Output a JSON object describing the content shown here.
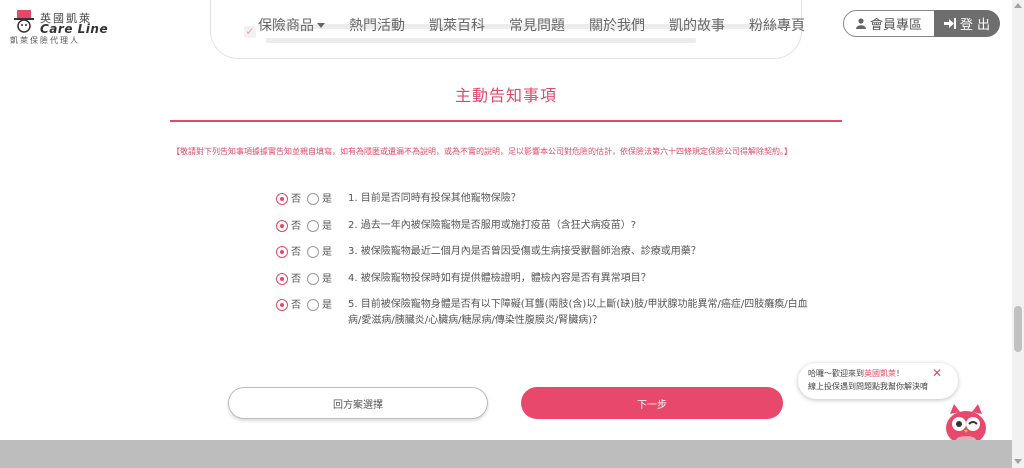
{
  "header": {
    "logo": {
      "zh_name": "英國凱萊",
      "en_name": "Care Line",
      "tagline": "凱萊保險代理人"
    },
    "nav": [
      {
        "label": "保險商品",
        "has_dropdown": true
      },
      {
        "label": "熱門活動"
      },
      {
        "label": "凱萊百科"
      },
      {
        "label": "常見問題"
      },
      {
        "label": "關於我們"
      },
      {
        "label": "凱的故事"
      },
      {
        "label": "粉絲專頁"
      }
    ],
    "member_label": "會員專區",
    "login_label": "登 出",
    "member_icon": "user-icon",
    "login_icon": "sign-in-icon"
  },
  "section": {
    "title": "主動告知事項",
    "notice": "【敬請對下列告知事項據據實告知並親自填寫，如有為隱匿或遺漏不為說明，或為不實的說明，足以影響本公司對危險的估計，依保險法第六十四條規定保險公司得解除契約。】"
  },
  "options": {
    "no": "否",
    "yes": "是"
  },
  "questions": [
    {
      "text": "1. 目前是否同時有投保其他寵物保險？",
      "answer": "no"
    },
    {
      "text": "2. 過去一年內被保險寵物是否服用或施打疫苗（含狂犬病疫苗）?",
      "answer": "no"
    },
    {
      "text": "3. 被保險寵物最近二個月內是否曾因受傷或生病接受獸醫師治療、診療或用藥？",
      "answer": "no"
    },
    {
      "text": "4. 被保險寵物投保時如有提供體檢證明，體檢內容是否有異常項目？",
      "answer": "no"
    },
    {
      "text": "5. 目前被保險寵物身體是否有以下障礙(耳聾(兩肢(含)以上斷(缺)肢/甲狀腺功能異常/癌症/四肢癱瘓/白血病/愛滋病/胰臟炎/心臟病/糖尿病/傳染性腹膜炎/腎臟病)？",
      "answer": "no"
    }
  ],
  "buttons": {
    "back": "回方案選擇",
    "next": "下一步"
  },
  "chat": {
    "greeting_prefix": "哈囉～歡迎來到",
    "greeting_brand": "英國凱萊",
    "greeting_suffix": "！",
    "line2": "線上投保遇到問題點我幫你解決唷",
    "close_icon": "close-icon"
  },
  "colors": {
    "accent": "#e24968",
    "button_next": "#e8486b",
    "login_bg": "#6e6e6e",
    "footer": "#bdbdbd"
  }
}
